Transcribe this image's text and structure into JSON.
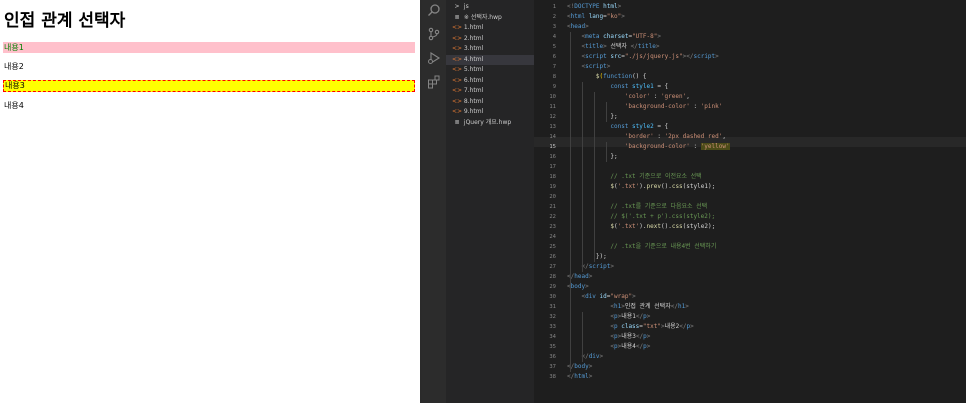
{
  "preview": {
    "heading": "인접 관계 선택자",
    "paragraphs": [
      "내용1",
      "내용2",
      "내용3",
      "내용4"
    ]
  },
  "explorer": {
    "items": [
      {
        "icon": "folder-chevron-icon",
        "glyph": ">",
        "label": "js",
        "active": false
      },
      {
        "icon": "word-doc-icon",
        "glyph": "≣",
        "label": "※ 선택자.hwp",
        "active": false
      },
      {
        "icon": "html-file-icon",
        "glyph": "<>",
        "label": "1.html",
        "active": false
      },
      {
        "icon": "html-file-icon",
        "glyph": "<>",
        "label": "2.html",
        "active": false
      },
      {
        "icon": "html-file-icon",
        "glyph": "<>",
        "label": "3.html",
        "active": false
      },
      {
        "icon": "html-file-icon",
        "glyph": "<>",
        "label": "4.html",
        "active": true
      },
      {
        "icon": "html-file-icon",
        "glyph": "<>",
        "label": "5.html",
        "active": false
      },
      {
        "icon": "html-file-icon",
        "glyph": "<>",
        "label": "6.html",
        "active": false
      },
      {
        "icon": "html-file-icon",
        "glyph": "<>",
        "label": "7.html",
        "active": false
      },
      {
        "icon": "html-file-icon",
        "glyph": "<>",
        "label": "8.html",
        "active": false
      },
      {
        "icon": "html-file-icon",
        "glyph": "<>",
        "label": "9.html",
        "active": false
      },
      {
        "icon": "word-doc-icon",
        "glyph": "≣",
        "label": "jQuery 개요.hwp",
        "active": false
      }
    ]
  },
  "editor": {
    "current_line": 15,
    "lines": [
      [
        [
          "t-punc",
          "<!"
        ],
        [
          "t-tag",
          "DOCTYPE"
        ],
        [
          "t-attr",
          " html"
        ],
        [
          "t-punc",
          ">"
        ]
      ],
      [
        [
          "t-punc",
          "<"
        ],
        [
          "t-tag",
          "html"
        ],
        [
          "t-attr",
          " lang"
        ],
        [
          "t-txt",
          "="
        ],
        [
          "t-str",
          "\"ko\""
        ],
        [
          "t-punc",
          ">"
        ]
      ],
      [
        [
          "t-punc",
          "<"
        ],
        [
          "t-tag",
          "head"
        ],
        [
          "t-punc",
          ">"
        ]
      ],
      [
        [
          "t-txt",
          "    "
        ],
        [
          "t-punc",
          "<"
        ],
        [
          "t-tag",
          "meta"
        ],
        [
          "t-attr",
          " charset"
        ],
        [
          "t-txt",
          "="
        ],
        [
          "t-str",
          "\"UTF-8\""
        ],
        [
          "t-punc",
          ">"
        ]
      ],
      [
        [
          "t-txt",
          "    "
        ],
        [
          "t-punc",
          "<"
        ],
        [
          "t-tag",
          "title"
        ],
        [
          "t-punc",
          ">"
        ],
        [
          "t-txt",
          " 선택자 "
        ],
        [
          "t-punc",
          "</"
        ],
        [
          "t-tag",
          "title"
        ],
        [
          "t-punc",
          ">"
        ]
      ],
      [
        [
          "t-txt",
          "    "
        ],
        [
          "t-punc",
          "<"
        ],
        [
          "t-tag",
          "script"
        ],
        [
          "t-attr",
          " src"
        ],
        [
          "t-txt",
          "="
        ],
        [
          "t-str",
          "\"./js/jquery.js\""
        ],
        [
          "t-punc",
          "></"
        ],
        [
          "t-tag",
          "script"
        ],
        [
          "t-punc",
          ">"
        ]
      ],
      [
        [
          "t-txt",
          "    "
        ],
        [
          "t-punc",
          "<"
        ],
        [
          "t-tag",
          "script"
        ],
        [
          "t-punc",
          ">"
        ]
      ],
      [
        [
          "t-txt",
          "        "
        ],
        [
          "t-fn",
          "$"
        ],
        [
          "t-brk",
          "("
        ],
        [
          "t-kw",
          "function"
        ],
        [
          "t-txt",
          "() {"
        ]
      ],
      [
        [
          "t-txt",
          "            "
        ],
        [
          "t-kw",
          "const"
        ],
        [
          "t-var",
          " style1"
        ],
        [
          "t-txt",
          " = {"
        ]
      ],
      [
        [
          "t-txt",
          "                "
        ],
        [
          "t-str",
          "'color'"
        ],
        [
          "t-txt",
          " : "
        ],
        [
          "t-str",
          "'green'"
        ],
        [
          "t-txt",
          ","
        ]
      ],
      [
        [
          "t-txt",
          "                "
        ],
        [
          "t-str",
          "'background-color'"
        ],
        [
          "t-txt",
          " : "
        ],
        [
          "t-str",
          "'pink'"
        ]
      ],
      [
        [
          "t-txt",
          "            };"
        ]
      ],
      [
        [
          "t-txt",
          "            "
        ],
        [
          "t-kw",
          "const"
        ],
        [
          "t-var",
          " style2"
        ],
        [
          "t-txt",
          " = {"
        ]
      ],
      [
        [
          "t-txt",
          "                "
        ],
        [
          "t-str",
          "'border'"
        ],
        [
          "t-txt",
          " : "
        ],
        [
          "t-str",
          "'2px dashed red'"
        ],
        [
          "t-txt",
          ","
        ]
      ],
      [
        [
          "t-txt",
          "                "
        ],
        [
          "t-str",
          "'background-color'"
        ],
        [
          "t-txt",
          " : "
        ],
        [
          "t-str",
          "'yellow'"
        ]
      ],
      [
        [
          "t-txt",
          "            };"
        ]
      ],
      [],
      [
        [
          "t-txt",
          "            "
        ],
        [
          "t-cmt",
          "// .txt 기준으로 이전요소 선택"
        ]
      ],
      [
        [
          "t-txt",
          "            "
        ],
        [
          "t-fn",
          "$"
        ],
        [
          "t-txt",
          "("
        ],
        [
          "t-str",
          "'.txt'"
        ],
        [
          "t-txt",
          ")."
        ],
        [
          "t-fn",
          "prev"
        ],
        [
          "t-txt",
          "()."
        ],
        [
          "t-fn",
          "css"
        ],
        [
          "t-txt",
          "(style1);"
        ]
      ],
      [],
      [
        [
          "t-txt",
          "            "
        ],
        [
          "t-cmt",
          "// .txt를 기준으로 다음요소 선택"
        ]
      ],
      [
        [
          "t-txt",
          "            "
        ],
        [
          "t-cmt",
          "// $('.txt + p').css(style2);"
        ]
      ],
      [
        [
          "t-txt",
          "            "
        ],
        [
          "t-fn",
          "$"
        ],
        [
          "t-txt",
          "("
        ],
        [
          "t-str",
          "'.txt'"
        ],
        [
          "t-txt",
          ")."
        ],
        [
          "t-fn",
          "next"
        ],
        [
          "t-txt",
          "()."
        ],
        [
          "t-fn",
          "css"
        ],
        [
          "t-txt",
          "(style2);"
        ]
      ],
      [],
      [
        [
          "t-txt",
          "            "
        ],
        [
          "t-cmt",
          "// .txt을 기준으로 내용4번 선택하기"
        ]
      ],
      [
        [
          "t-txt",
          "        "
        ],
        [
          "t-txt",
          "});"
        ]
      ],
      [
        [
          "t-txt",
          "    "
        ],
        [
          "t-punc",
          "</"
        ],
        [
          "t-tag",
          "script"
        ],
        [
          "t-punc",
          ">"
        ]
      ],
      [
        [
          "t-punc",
          "</"
        ],
        [
          "t-tag",
          "head"
        ],
        [
          "t-punc",
          ">"
        ]
      ],
      [
        [
          "t-punc",
          "<"
        ],
        [
          "t-tag",
          "body"
        ],
        [
          "t-punc",
          ">"
        ]
      ],
      [
        [
          "t-txt",
          "    "
        ],
        [
          "t-punc",
          "<"
        ],
        [
          "t-tag",
          "div"
        ],
        [
          "t-attr",
          " id"
        ],
        [
          "t-txt",
          "="
        ],
        [
          "t-str",
          "\"wrap\""
        ],
        [
          "t-punc",
          ">"
        ]
      ],
      [
        [
          "t-txt",
          "            "
        ],
        [
          "t-punc",
          "<"
        ],
        [
          "t-tag",
          "h1"
        ],
        [
          "t-punc",
          ">"
        ],
        [
          "t-txt",
          "인접 관계 선택자"
        ],
        [
          "t-punc",
          "</"
        ],
        [
          "t-tag",
          "h1"
        ],
        [
          "t-punc",
          ">"
        ]
      ],
      [
        [
          "t-txt",
          "            "
        ],
        [
          "t-punc",
          "<"
        ],
        [
          "t-tag",
          "p"
        ],
        [
          "t-punc",
          ">"
        ],
        [
          "t-txt",
          "내용1"
        ],
        [
          "t-punc",
          "</"
        ],
        [
          "t-tag",
          "p"
        ],
        [
          "t-punc",
          ">"
        ]
      ],
      [
        [
          "t-txt",
          "            "
        ],
        [
          "t-punc",
          "<"
        ],
        [
          "t-tag",
          "p"
        ],
        [
          "t-attr",
          " class"
        ],
        [
          "t-txt",
          "="
        ],
        [
          "t-str",
          "\"txt\""
        ],
        [
          "t-punc",
          ">"
        ],
        [
          "t-txt",
          "내용2"
        ],
        [
          "t-punc",
          "</"
        ],
        [
          "t-tag",
          "p"
        ],
        [
          "t-punc",
          ">"
        ]
      ],
      [
        [
          "t-txt",
          "            "
        ],
        [
          "t-punc",
          "<"
        ],
        [
          "t-tag",
          "p"
        ],
        [
          "t-punc",
          ">"
        ],
        [
          "t-txt",
          "내용3"
        ],
        [
          "t-punc",
          "</"
        ],
        [
          "t-tag",
          "p"
        ],
        [
          "t-punc",
          ">"
        ]
      ],
      [
        [
          "t-txt",
          "            "
        ],
        [
          "t-punc",
          "<"
        ],
        [
          "t-tag",
          "p"
        ],
        [
          "t-punc",
          ">"
        ],
        [
          "t-txt",
          "내용4"
        ],
        [
          "t-punc",
          "</"
        ],
        [
          "t-tag",
          "p"
        ],
        [
          "t-punc",
          ">"
        ]
      ],
      [
        [
          "t-txt",
          "    "
        ],
        [
          "t-punc",
          "</"
        ],
        [
          "t-tag",
          "div"
        ],
        [
          "t-punc",
          ">"
        ]
      ],
      [
        [
          "t-punc",
          "</"
        ],
        [
          "t-tag",
          "body"
        ],
        [
          "t-punc",
          ">"
        ]
      ],
      [
        [
          "t-punc",
          "</"
        ],
        [
          "t-tag",
          "html"
        ],
        [
          "t-punc",
          ">"
        ]
      ]
    ]
  }
}
